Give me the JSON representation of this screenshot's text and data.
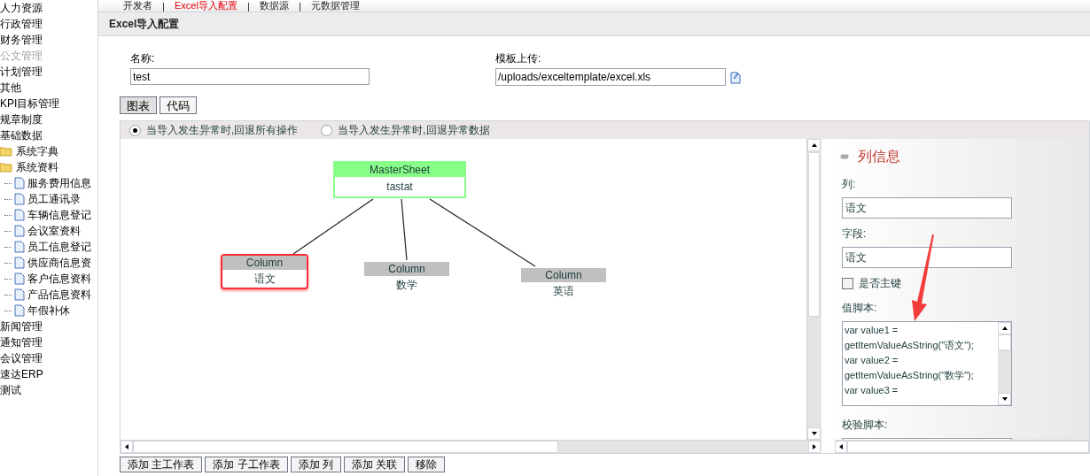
{
  "top_tabs": [
    {
      "label": "开发者",
      "selected": false
    },
    {
      "label": "Excel导入配置",
      "selected": true
    },
    {
      "label": "数据源",
      "selected": false
    },
    {
      "label": "元数据管理",
      "selected": false
    }
  ],
  "sidebar": {
    "items": [
      {
        "label": "人力资源",
        "disabled": false
      },
      {
        "label": "行政管理",
        "disabled": false
      },
      {
        "label": "财务管理",
        "disabled": false
      },
      {
        "label": "公文管理",
        "disabled": true
      },
      {
        "label": "计划管理",
        "disabled": false
      },
      {
        "label": "其他",
        "disabled": false
      },
      {
        "label": "KPI目标管理",
        "disabled": false
      },
      {
        "label": "规章制度",
        "disabled": false
      },
      {
        "label": "基础数据",
        "disabled": false,
        "children": [
          {
            "label": "系统字典",
            "kind": "folder"
          },
          {
            "label": "系统资料",
            "kind": "folder",
            "children": [
              {
                "label": "服务费用信息",
                "kind": "page"
              },
              {
                "label": "员工通讯录",
                "kind": "page"
              },
              {
                "label": "车辆信息登记",
                "kind": "page"
              },
              {
                "label": "会议室资料",
                "kind": "page"
              },
              {
                "label": "员工信息登记",
                "kind": "page"
              },
              {
                "label": "供应商信息资",
                "kind": "page"
              },
              {
                "label": "客户信息资料",
                "kind": "page"
              },
              {
                "label": "产品信息资料",
                "kind": "page"
              },
              {
                "label": "年假补休",
                "kind": "page"
              }
            ]
          }
        ]
      },
      {
        "label": "新闻管理",
        "disabled": false
      },
      {
        "label": "通知管理",
        "disabled": false
      },
      {
        "label": "会议管理",
        "disabled": false
      },
      {
        "label": "速达ERP",
        "disabled": false
      },
      {
        "label": "测试",
        "disabled": false
      }
    ]
  },
  "page_title": "Excel导入配置",
  "form": {
    "name_label": "名称:",
    "name_value": "test",
    "template_label": "模板上传:",
    "template_value": "/uploads/exceltemplate/excel.xls"
  },
  "view_buttons": [
    {
      "label": "图表",
      "selected": true
    },
    {
      "label": "代码",
      "selected": false
    }
  ],
  "rollback_options": [
    {
      "label": "当导入发生异常时,回退所有操作",
      "selected": true
    },
    {
      "label": "当导入发生异常时,回退异常数据",
      "selected": false
    }
  ],
  "diagram": {
    "nodes": [
      {
        "kind": "master",
        "header": "MasterSheet",
        "label": "tastat",
        "selected": false
      },
      {
        "kind": "column",
        "header": "Column",
        "label": "语文",
        "selected": true
      },
      {
        "kind": "column",
        "header": "Column",
        "label": "数学",
        "selected": false
      },
      {
        "kind": "column",
        "header": "Column",
        "label": "英语",
        "selected": false
      }
    ]
  },
  "column_info": {
    "title": "列信息",
    "column_label": "列:",
    "column_value": "语文",
    "field_label": "字段:",
    "field_value": "语文",
    "primary_key_label": "是否主键",
    "primary_key_checked": false,
    "value_script_label": "值脚本:",
    "value_script": "var value1 = getItemValueAsString(\"语文\");\nvar value2 = getItemValueAsString(\"数学\");\nvar value3 =",
    "validate_script_label": "校验脚本:"
  },
  "action_buttons": [
    "添加 主工作表",
    "添加 子工作表",
    "添加 列",
    "添加 关联",
    "移除"
  ]
}
